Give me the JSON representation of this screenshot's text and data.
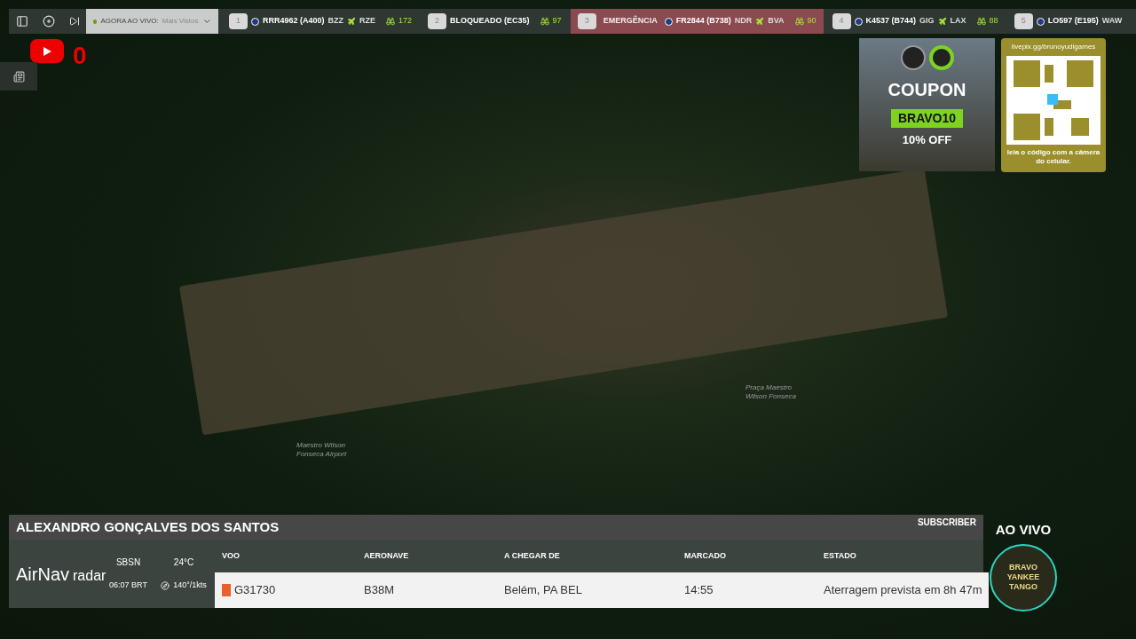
{
  "toolbar": {
    "live_label": "AGORA AO VIVO:",
    "live_value": "Mais Vistos"
  },
  "flights": [
    {
      "number": "1",
      "alert": false,
      "title": "RRR4962 (A400)",
      "route_from": "BZZ",
      "route_to": "RZE",
      "viewers": "172"
    },
    {
      "number": "2",
      "alert": false,
      "title": "BLOQUEADO (EC35)",
      "viewers": "97"
    },
    {
      "number": "3",
      "alert": true,
      "status": "EMERGÊNCIA",
      "title": "FR2844 (B738)",
      "route_from": "NDR",
      "route_to": "BVA",
      "viewers": "90"
    },
    {
      "number": "4",
      "alert": false,
      "title": "K4537 (B744)",
      "route_from": "GIG",
      "route_to": "LAX",
      "viewers": "88"
    },
    {
      "number": "5",
      "alert": false,
      "title": "LO597 (E195)",
      "route_from": "WAW"
    }
  ],
  "youtube": {
    "count": "0"
  },
  "map_labels": [
    "Maestro Wilson Fonseca Airport",
    "Praça Maestro Wilson Fonseca"
  ],
  "coupon": {
    "title": "COUPON",
    "code": "BRAVO10",
    "discount": "10% OFF"
  },
  "qr": {
    "url": "livepix.gg/brunoyudigames",
    "caption": "leia o código com a câmera do celular."
  },
  "flight_panel": {
    "name": "ALEXANDRO GONÇALVES DOS SANTOS",
    "badge": "SUBSCRIBER",
    "brand_main": "AirNav",
    "brand_sub": "radar",
    "airport": "SBSN",
    "time": "06:07 BRT",
    "temperature": "24°C",
    "wind": "140°/1kts",
    "columns": [
      "VOO",
      "AERONAVE",
      "A CHEGAR DE",
      "MARCADO",
      "ESTADO"
    ],
    "row": [
      "G31730",
      "B38M",
      "Belém, PA BEL",
      "14:55",
      "Aterragem prevista em 8h 47m"
    ]
  },
  "live": {
    "label": "AO VIVO",
    "logo_text": "BRAVO YANKEE TANGO"
  }
}
